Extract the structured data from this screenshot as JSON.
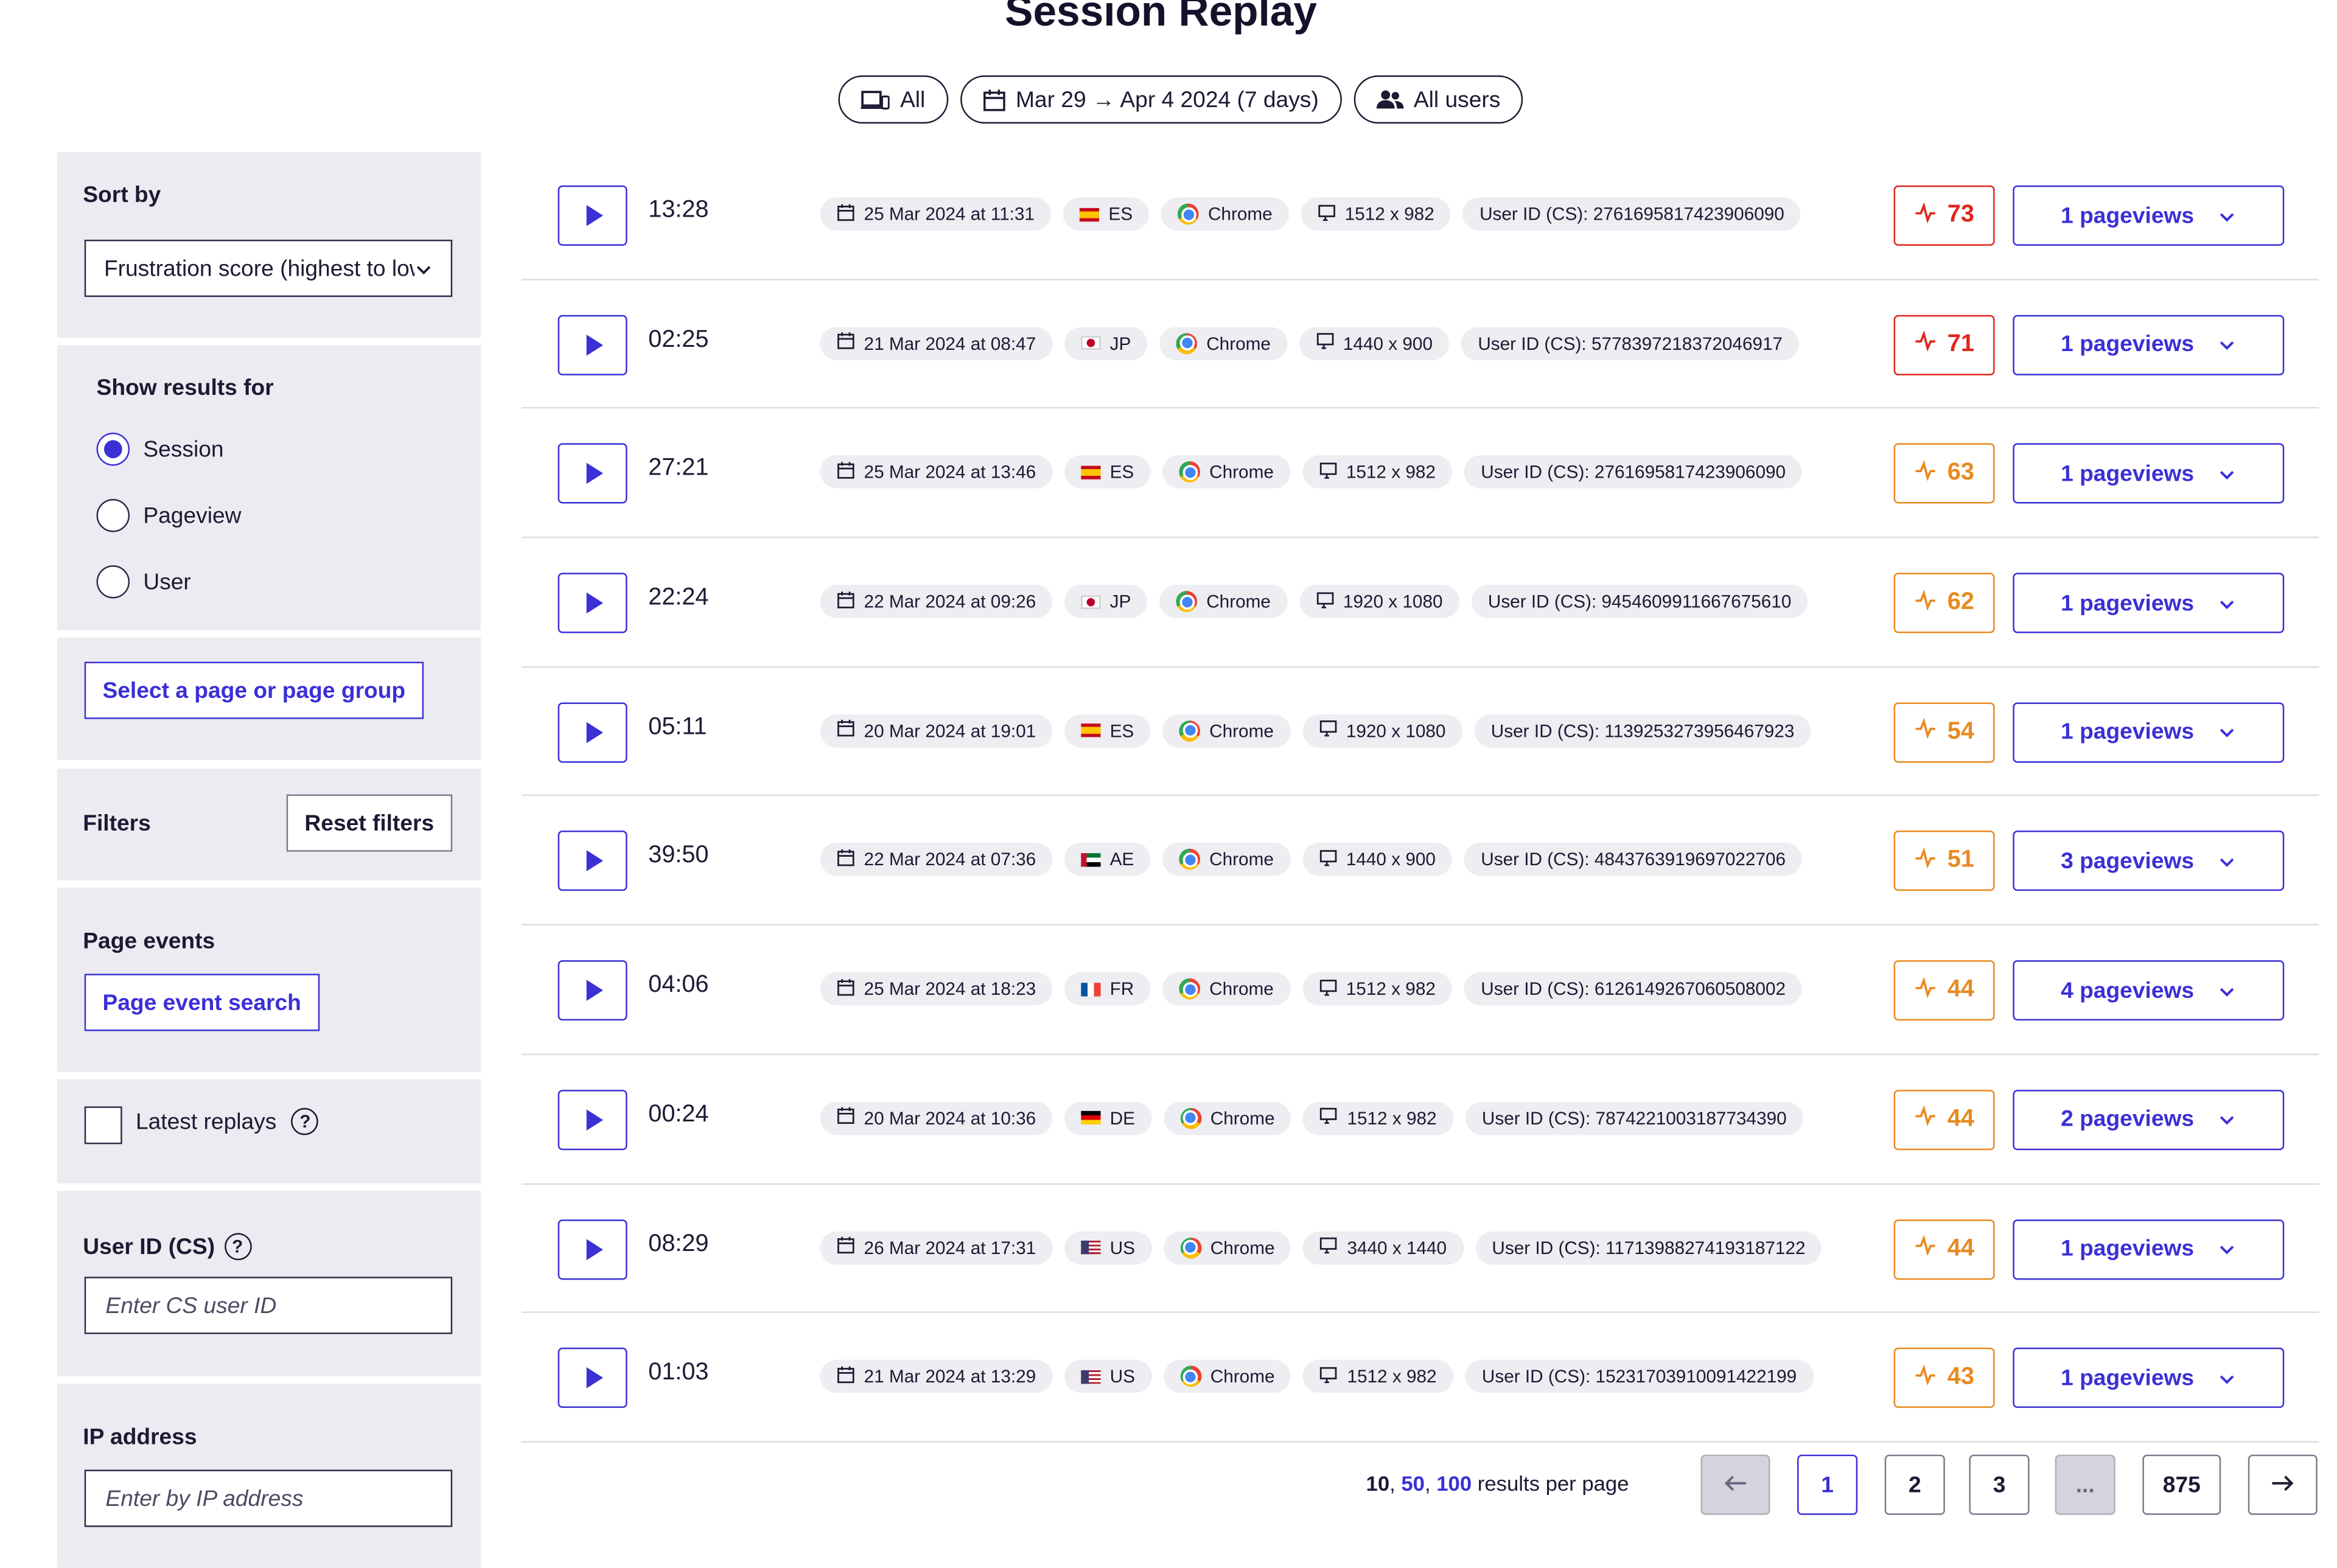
{
  "title": "Session Replay",
  "header_chips": [
    {
      "icon": "device-icon",
      "label": "All"
    },
    {
      "icon": "calendar-icon",
      "label": "Mar 29 → Apr 4 2024 (7 days)"
    },
    {
      "icon": "users-icon",
      "label": "All users"
    }
  ],
  "sidebar": {
    "sort_by": {
      "label": "Sort by",
      "value": "Frustration score (highest to lowest)"
    },
    "show_results": {
      "label": "Show results for",
      "options": [
        {
          "label": "Session",
          "selected": true
        },
        {
          "label": "Pageview",
          "selected": false
        },
        {
          "label": "User",
          "selected": false
        }
      ]
    },
    "page_select_button": "Select a page or page group",
    "filters": {
      "label": "Filters",
      "reset_label": "Reset filters"
    },
    "page_events": {
      "label": "Page events",
      "button": "Page event search"
    },
    "latest_replays": {
      "label": "Latest replays",
      "checked": false
    },
    "user_id": {
      "label": "User ID (CS)",
      "placeholder": "Enter CS user ID"
    },
    "ip_address": {
      "label": "IP address",
      "placeholder": "Enter by IP address"
    },
    "help_glyph": "?"
  },
  "sessions": [
    {
      "duration": "13:28",
      "date": "25 Mar 2024 at 11:31",
      "country": "ES",
      "browser": "Chrome",
      "resolution": "1512 x 982",
      "user_id": "User ID (CS): 2761695817423906090",
      "score": 73,
      "score_level": "red",
      "pageviews": "1 pageviews"
    },
    {
      "duration": "02:25",
      "date": "21 Mar 2024 at 08:47",
      "country": "JP",
      "browser": "Chrome",
      "resolution": "1440 x 900",
      "user_id": "User ID (CS): 5778397218372046917",
      "score": 71,
      "score_level": "red",
      "pageviews": "1 pageviews"
    },
    {
      "duration": "27:21",
      "date": "25 Mar 2024 at 13:46",
      "country": "ES",
      "browser": "Chrome",
      "resolution": "1512 x 982",
      "user_id": "User ID (CS): 2761695817423906090",
      "score": 63,
      "score_level": "orange",
      "pageviews": "1 pageviews"
    },
    {
      "duration": "22:24",
      "date": "22 Mar 2024 at 09:26",
      "country": "JP",
      "browser": "Chrome",
      "resolution": "1920 x 1080",
      "user_id": "User ID (CS): 9454609911667675610",
      "score": 62,
      "score_level": "orange",
      "pageviews": "1 pageviews"
    },
    {
      "duration": "05:11",
      "date": "20 Mar 2024 at 19:01",
      "country": "ES",
      "browser": "Chrome",
      "resolution": "1920 x 1080",
      "user_id": "User ID (CS): 11392532739564679​23",
      "score": 54,
      "score_level": "orange",
      "pageviews": "1 pageviews"
    },
    {
      "duration": "39:50",
      "date": "22 Mar 2024 at 07:36",
      "country": "AE",
      "browser": "Chrome",
      "resolution": "1440 x 900",
      "user_id": "User ID (CS): 4843763919697022706",
      "score": 51,
      "score_level": "orange",
      "pageviews": "3 pageviews"
    },
    {
      "duration": "04:06",
      "date": "25 Mar 2024 at 18:23",
      "country": "FR",
      "browser": "Chrome",
      "resolution": "1512 x 982",
      "user_id": "User ID (CS): 6126149267060508002",
      "score": 44,
      "score_level": "orange",
      "pageviews": "4 pageviews"
    },
    {
      "duration": "00:24",
      "date": "20 Mar 2024 at 10:36",
      "country": "DE",
      "browser": "Chrome",
      "resolution": "1512 x 982",
      "user_id": "User ID (CS): 7874221003187734390",
      "score": 44,
      "score_level": "orange",
      "pageviews": "2 pageviews"
    },
    {
      "duration": "08:29",
      "date": "26 Mar 2024 at 17:31",
      "country": "US",
      "browser": "Chrome",
      "resolution": "3440 x 1440",
      "user_id": "User ID (CS): 11713988274193187122",
      "score": 44,
      "score_level": "orange",
      "pageviews": "1 pageviews"
    },
    {
      "duration": "01:03",
      "date": "21 Mar 2024 at 13:29",
      "country": "US",
      "browser": "Chrome",
      "resolution": "1512 x 982",
      "user_id": "User ID (CS): 15231703910091422199",
      "score": 43,
      "score_level": "orange",
      "pageviews": "1 pageviews"
    }
  ],
  "pagination": {
    "per_page_options": [
      "10",
      "50",
      "100"
    ],
    "per_page_selected": "10",
    "per_page_suffix": "results per page",
    "pages": [
      "1",
      "2",
      "3",
      "...",
      "875"
    ],
    "current_page": "1"
  },
  "colors": {
    "accent": "#3b2fd6",
    "score_red": "#e0271c",
    "score_orange": "#e88a20"
  }
}
